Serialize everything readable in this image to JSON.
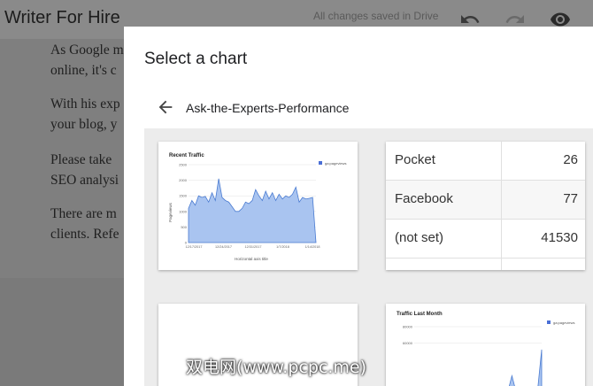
{
  "app": {
    "doc_title": "Writer For Hire",
    "save_status": "All changes saved in Drive",
    "icons": [
      "undo-icon",
      "redo-icon",
      "preview-eye-icon"
    ]
  },
  "document": {
    "paragraphs": [
      {
        "line1": "As Google m",
        "line2": "online, it's c"
      },
      {
        "line1": "With his exp",
        "line2": "your blog, y"
      },
      {
        "line1": "Please take",
        "line2": "SEO analysi"
      },
      {
        "line1": "There are m",
        "line2": "clients. Refe"
      }
    ]
  },
  "dialog": {
    "title": "Select a chart",
    "breadcrumb": "Ask-the-Experts-Performance",
    "colors": {
      "series": "#a9c4f0",
      "series_stroke": "#4a7bd1",
      "legend": "#4a6fd6"
    }
  },
  "cards": {
    "recent_traffic": {
      "chart_data": {
        "type": "area",
        "title": "Recent Traffic",
        "xlabel": "Horizontal axis title",
        "ylabel": "Pageviews",
        "legend": "ga:pageviews",
        "legend_position": "top-right",
        "ylim": [
          0,
          2500
        ],
        "yticks": [
          "2500",
          "2000",
          "1500",
          "1000",
          "500",
          "0"
        ],
        "xticks": [
          "12/17/2017",
          "12/24/2017",
          "12/31/2017",
          "1/7/2018",
          "1/14/2018"
        ],
        "values": [
          1100,
          1350,
          1200,
          1500,
          1450,
          1480,
          1300,
          1600,
          1350,
          2050,
          1450,
          1350,
          1300,
          1150,
          1000,
          1000,
          1100,
          1300,
          1250,
          1350,
          1700,
          1500,
          1350,
          1650,
          1400,
          1600,
          1350,
          1550,
          1400,
          1500,
          1450,
          1550,
          1780,
          1300,
          1450,
          1400,
          1420,
          1450,
          0
        ]
      }
    },
    "sources_table": {
      "rows": [
        {
          "key": "Pocket",
          "value": "26"
        },
        {
          "key": "Facebook",
          "value": "77"
        },
        {
          "key": "(not set)",
          "value": "41530"
        }
      ]
    },
    "traffic_last_month": {
      "chart_data": {
        "type": "area",
        "title": "Traffic Last Month",
        "legend": "ga:pageviews",
        "legend_position": "top-right",
        "yticks": [
          "80000",
          "60000"
        ],
        "values": [
          0,
          0,
          0,
          0,
          0,
          0,
          0,
          0,
          0,
          0,
          0,
          0,
          0,
          0,
          0,
          0,
          0,
          0,
          0,
          0,
          0,
          0,
          0,
          20000,
          0,
          0,
          0,
          0,
          0,
          0,
          52000
        ]
      }
    }
  },
  "watermark": "双电网(www.pcpc.me)"
}
